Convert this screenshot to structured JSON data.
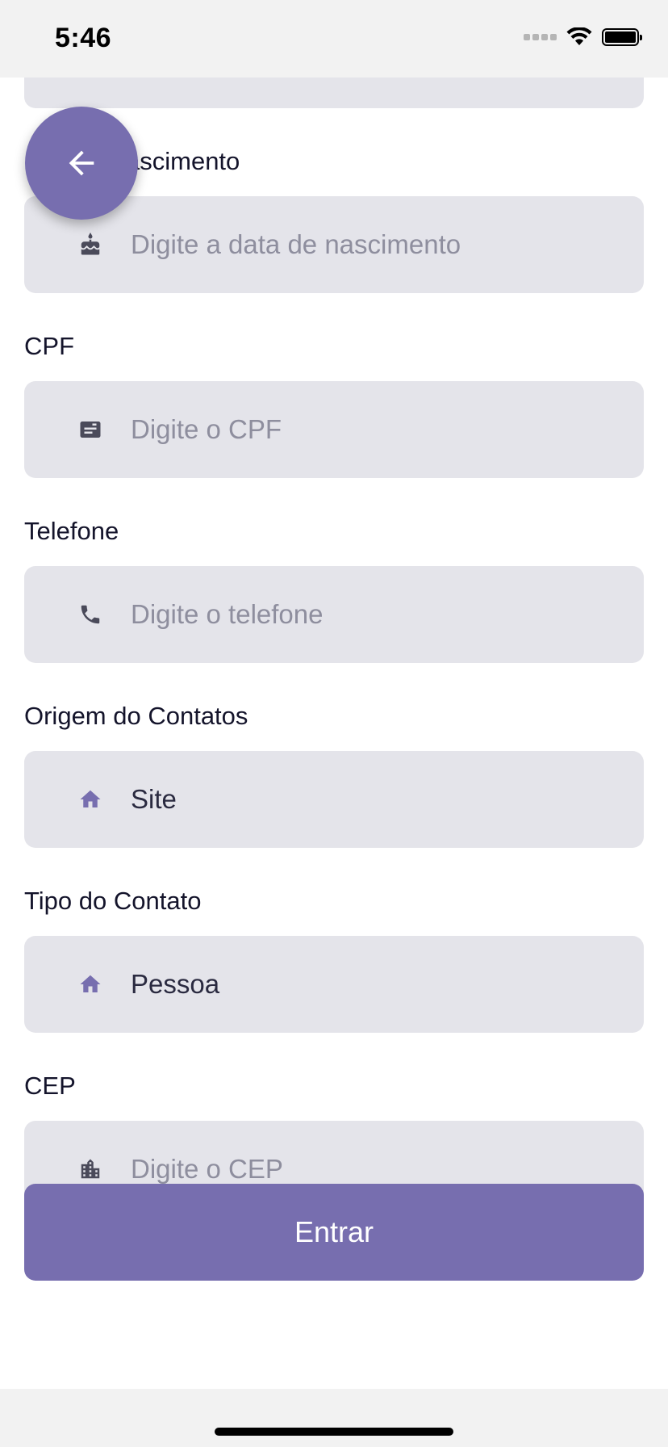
{
  "status_bar": {
    "time": "5:46"
  },
  "back_button": {
    "icon": "arrow-left-icon"
  },
  "form": {
    "fields": [
      {
        "label": "Data de nascimento",
        "label_visible": "ascimento",
        "icon": "cake-icon",
        "placeholder": "Digite a data de nascimento",
        "value": ""
      },
      {
        "label": "CPF",
        "icon": "id-card-icon",
        "placeholder": "Digite o CPF",
        "value": ""
      },
      {
        "label": "Telefone",
        "icon": "phone-icon",
        "placeholder": "Digite o telefone",
        "value": ""
      },
      {
        "label": "Origem do Contatos",
        "icon": "home-icon",
        "placeholder": "",
        "value": "Site"
      },
      {
        "label": "Tipo do Contato",
        "icon": "home-icon",
        "placeholder": "",
        "value": "Pessoa"
      },
      {
        "label": "CEP",
        "icon": "building-icon",
        "placeholder": "Digite o CEP",
        "value": ""
      }
    ],
    "submit_label": "Entrar"
  },
  "colors": {
    "accent": "#776eaf",
    "field_background": "#e4e4ea",
    "placeholder_text": "#8e8e9e",
    "value_text": "#2a2a40",
    "label_text": "#14142b",
    "icon_neutral": "#4a4a5a"
  }
}
